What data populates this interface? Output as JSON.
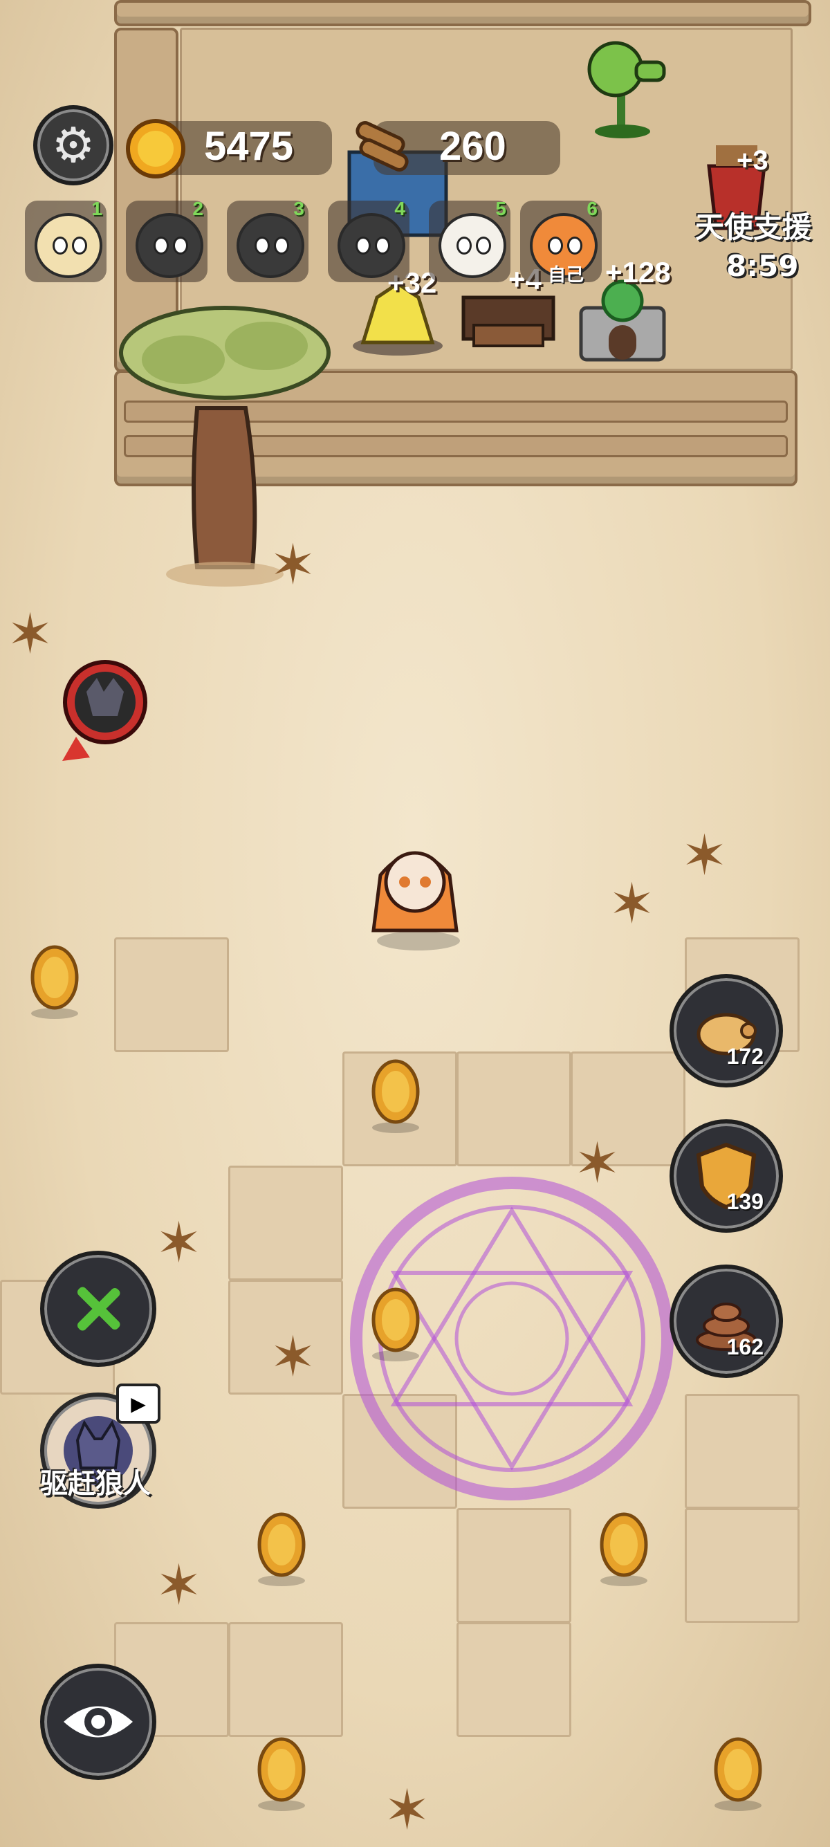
{
  "hud": {
    "settings_icon": "gear-icon",
    "coins": "5475",
    "wood": "260",
    "angel_support_label": "天使支援",
    "angel_support_timer": "8:59"
  },
  "players": [
    {
      "rank": "1",
      "avatar": "sheep-santa"
    },
    {
      "rank": "2",
      "avatar": "sheep-black"
    },
    {
      "rank": "3",
      "avatar": "sheep-black-angry"
    },
    {
      "rank": "4",
      "avatar": "sheep-black-glasses"
    },
    {
      "rank": "5",
      "avatar": "sheep-maid"
    },
    {
      "rank": "6",
      "avatar": "sheep-fox-hood",
      "tag": "自己"
    }
  ],
  "world": {
    "float_gains": [
      "+32",
      "+4",
      "+128",
      "+3"
    ]
  },
  "side_buttons": [
    {
      "name": "piggy-bank",
      "icon": "piggy-bank-icon",
      "count": "172"
    },
    {
      "name": "shield",
      "icon": "shield-icon",
      "count": "139"
    },
    {
      "name": "poop",
      "icon": "poop-icon",
      "count": "162"
    }
  ],
  "tools": {
    "build_icon": "wrench-hammer-icon",
    "expel_wolf_label": "驱赶狼人",
    "expel_wolf_icon": "video-ad-icon",
    "view_icon": "eye-icon"
  },
  "colors": {
    "ground": "#ecdcbe",
    "magic_circle": "#b04fd8",
    "rank_green": "#7fd85a"
  }
}
